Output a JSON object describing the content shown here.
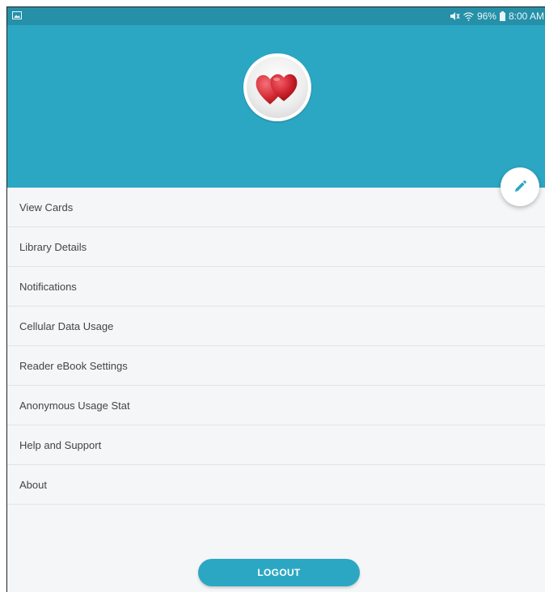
{
  "status_bar": {
    "battery": "96%",
    "time": "8:00 AM",
    "icons": [
      "gallery-icon",
      "mute-icon",
      "wifi-icon",
      "battery-icon"
    ]
  },
  "header": {
    "background": "#2ca7c3",
    "avatar_icon": "hearts-icon"
  },
  "edit_button": {
    "icon": "pencil-icon",
    "color": "#2ca7c3"
  },
  "menu": {
    "items": [
      {
        "label": "View Cards"
      },
      {
        "label": "Library Details"
      },
      {
        "label": "Notifications"
      },
      {
        "label": "Cellular Data Usage"
      },
      {
        "label": "Reader eBook Settings"
      },
      {
        "label": "Anonymous Usage Stat"
      },
      {
        "label": "Help and Support"
      },
      {
        "label": "About"
      }
    ]
  },
  "logout": {
    "label": "LOGOUT"
  },
  "colors": {
    "accent": "#2ca7c3",
    "status_bar": "#2590a8",
    "page_background": "#f5f6f7"
  }
}
